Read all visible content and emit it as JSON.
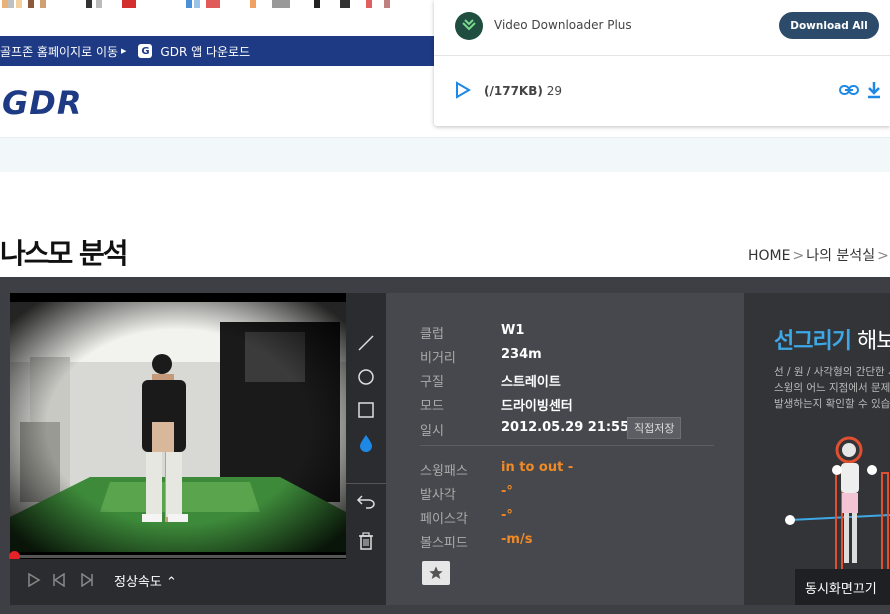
{
  "browser_popup": {
    "extension_name": "Video Downloader Plus",
    "download_all_label": "Download All",
    "file_size": "(/177KB)",
    "file_count": "29"
  },
  "site": {
    "topbar_link1": "골프존 홈페이지로 이동",
    "topbar_link2": "GDR 앱 다운로드",
    "logo_text": "GDR",
    "logo_icon_letter": "G"
  },
  "page": {
    "title": "나스모 분석",
    "breadcrumb": [
      "HOME",
      "나의 분석실"
    ]
  },
  "player": {
    "speed_label": "정상속도",
    "progress": 0
  },
  "info": {
    "rows": [
      {
        "label": "클럽",
        "value": "W1"
      },
      {
        "label": "비거리",
        "value": "234m"
      },
      {
        "label": "구질",
        "value": "스트레이트"
      },
      {
        "label": "모드",
        "value": "드라이빙센터"
      },
      {
        "label": "일시",
        "value": "2012.05.29 21:55"
      }
    ],
    "save_label": "직접저장",
    "metrics": [
      {
        "label": "스윙패스",
        "value": "in to out -"
      },
      {
        "label": "발사각",
        "value": "-°"
      },
      {
        "label": "페이스각",
        "value": "-°"
      },
      {
        "label": "볼스피드",
        "value": "-m/s"
      }
    ]
  },
  "guide": {
    "title_highlight": "선그리기",
    "title_rest": " 해보",
    "desc_lines": [
      "선 / 원 / 사각형의 간단한 시",
      "스윙의 어느 지점에서 문제",
      "발생하는지 확인할 수 있습"
    ],
    "dual_view_label": "동시화면끄기"
  },
  "colors": {
    "brand_blue": "#1e3a84",
    "panel_bg": "#3d3f44",
    "accent_orange": "#f08a24",
    "guide_blue": "#3ea7e6",
    "progress_red": "#e52226"
  }
}
